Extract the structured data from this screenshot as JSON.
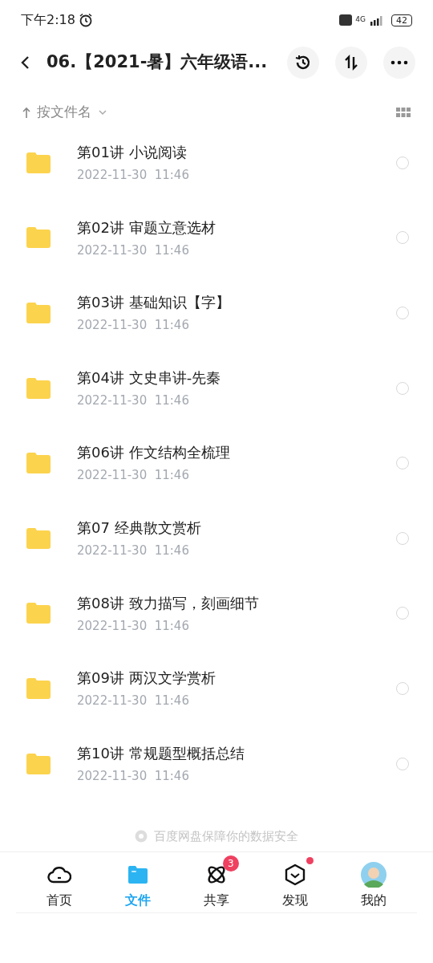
{
  "status_bar": {
    "time": "下午2:18",
    "network": "4G",
    "battery": "42"
  },
  "header": {
    "title": "06.【2021-暑】六年级语..."
  },
  "sort_bar": {
    "label": "按文件名"
  },
  "files": [
    {
      "name": "第01讲 小说阅读",
      "date": "2022-11-30  11:46",
      "selected": false
    },
    {
      "name": "第02讲 审题立意选材",
      "date": "2022-11-30  11:46",
      "selected": false
    },
    {
      "name": "第03讲 基础知识【字】",
      "date": "2022-11-30  11:46",
      "selected": false
    },
    {
      "name": "第04讲 文史串讲-先秦",
      "date": "2022-11-30  11:46",
      "selected": false
    },
    {
      "name": "第06讲 作文结构全梳理",
      "date": "2022-11-30  11:46",
      "selected": false
    },
    {
      "name": "第07 经典散文赏析",
      "date": "2022-11-30  11:46",
      "selected": false
    },
    {
      "name": "第08讲 致力描写，刻画细节",
      "date": "2022-11-30  11:46",
      "selected": false
    },
    {
      "name": "第09讲 两汉文学赏析",
      "date": "2022-11-30  11:46",
      "selected": false
    },
    {
      "name": "第10讲 常规题型概括总结",
      "date": "2022-11-30  11:46",
      "selected": false
    }
  ],
  "footer_note": "百度网盘保障你的数据安全",
  "tabs": [
    {
      "kind": "home",
      "label": "首页",
      "selected": false
    },
    {
      "kind": "files",
      "label": "文件",
      "selected": true
    },
    {
      "kind": "share",
      "label": "共享",
      "selected": false,
      "badge": "3"
    },
    {
      "kind": "discover",
      "label": "发现",
      "selected": false,
      "dot": true
    },
    {
      "kind": "me",
      "label": "我的",
      "selected": false
    }
  ]
}
